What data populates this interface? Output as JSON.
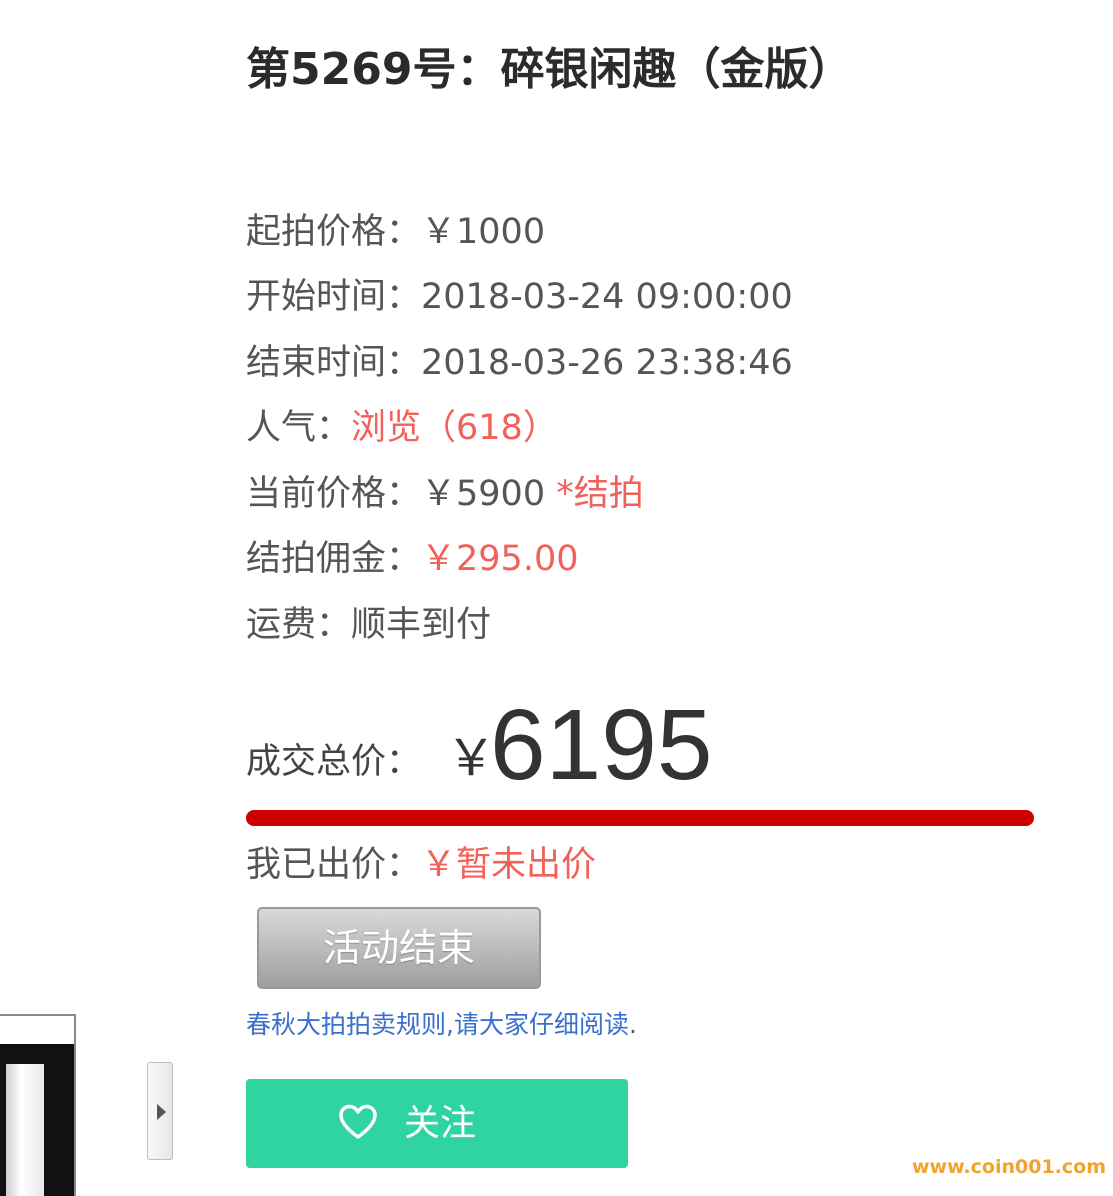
{
  "lot": {
    "title": "第5269号：碎银闲趣（金版）"
  },
  "details": {
    "start_price_label": "起拍价格：",
    "start_price_value": "￥1000",
    "start_time_label": "开始时间：",
    "start_time_value": "2018-03-24 09:00:00",
    "end_time_label": "结束时间：",
    "end_time_value": "2018-03-26 23:38:46",
    "popularity_label": "人气：",
    "popularity_value": "浏览（618）",
    "current_price_label": "当前价格：",
    "current_price_value": "￥5900",
    "current_price_status": "*结拍",
    "commission_label": "结拍佣金：",
    "commission_value": "￥295.00",
    "shipping_label": "运费：",
    "shipping_value": "顺丰到付"
  },
  "total": {
    "label": "成交总价：",
    "currency": "￥",
    "value": "6195"
  },
  "my_bid": {
    "label": "我已出价：",
    "value": "￥暂未出价"
  },
  "buttons": {
    "activity_ended": "活动结束",
    "follow": "关注"
  },
  "rules": {
    "link_text": "春秋大拍拍卖规则,请大家仔细阅读",
    "trailing": "."
  },
  "watermark": {
    "text": "www.coin001.com"
  },
  "icons": {
    "follow": "heart-outline-icon",
    "next": "triangle-right-icon"
  },
  "colors": {
    "accent_red": "#f2605a",
    "bar_red": "#cc0000",
    "follow_green": "#2fd4a1",
    "link_blue": "#3b6fcf",
    "watermark_orange": "#f2a32d"
  }
}
